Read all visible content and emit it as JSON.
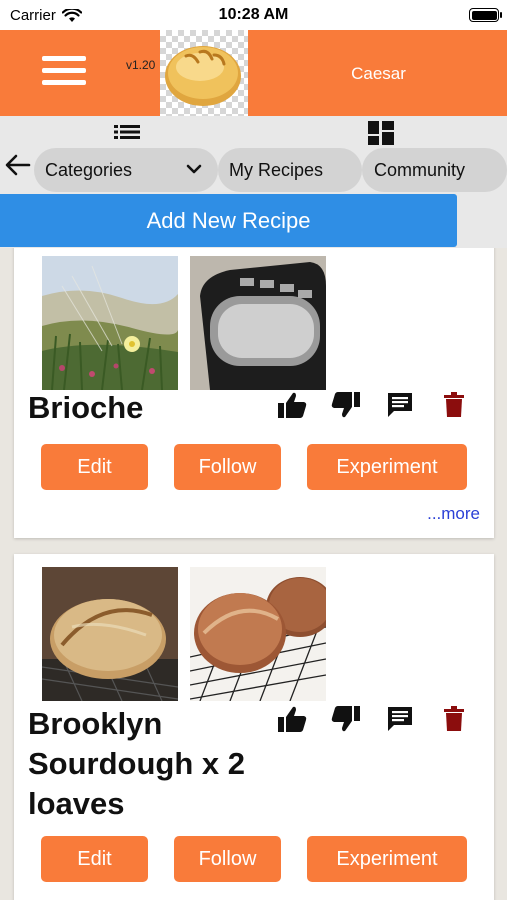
{
  "status_bar": {
    "carrier": "Carrier",
    "time": "10:28 AM"
  },
  "header": {
    "version": "v1.20",
    "user": "Caesar"
  },
  "nav": {
    "categories_label": "Categories",
    "my_recipes_label": "My Recipes",
    "community_label": "Community",
    "add_recipe_label": "Add New Recipe"
  },
  "recipes": [
    {
      "title": "Brioche",
      "edit": "Edit",
      "follow": "Follow",
      "experiment": "Experiment",
      "more": "...more"
    },
    {
      "title": "Brooklyn Sourdough x 2 loaves",
      "edit": "Edit",
      "follow": "Follow",
      "experiment": "Experiment"
    }
  ],
  "colors": {
    "header": "#f97b3a",
    "button": "#f97b3a",
    "add_button": "#2f8ee5",
    "delete_icon": "#8b0d0d",
    "link": "#2a3fd6"
  },
  "icons": [
    "menu-icon",
    "list-view-icon",
    "grid-view-icon",
    "back-arrow-icon",
    "chevron-down-icon",
    "thumbs-up-icon",
    "thumbs-down-icon",
    "comment-icon",
    "trash-icon"
  ]
}
